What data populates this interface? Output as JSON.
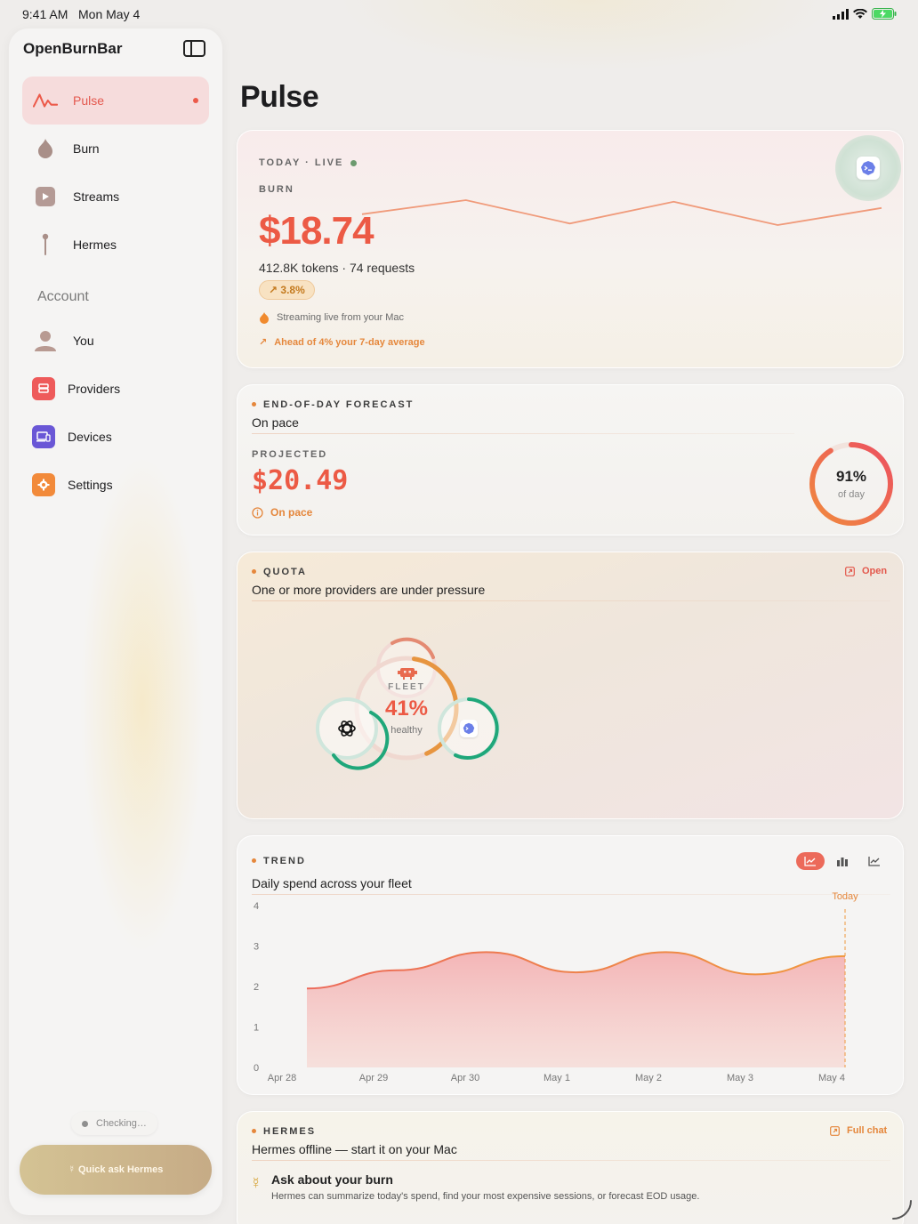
{
  "status_bar": {
    "time": "9:41 AM",
    "date": "Mon May 4"
  },
  "sidebar": {
    "title": "OpenBurnBar",
    "items": [
      {
        "label": "Pulse",
        "icon": "pulse-icon",
        "active": true
      },
      {
        "label": "Burn",
        "icon": "flame-icon"
      },
      {
        "label": "Streams",
        "icon": "play-icon"
      },
      {
        "label": "Hermes",
        "icon": "hermes-staff-icon"
      }
    ],
    "section_label": "Account",
    "account_items": [
      {
        "label": "You",
        "icon": "person-icon"
      },
      {
        "label": "Providers",
        "icon": "providers-icon"
      },
      {
        "label": "Devices",
        "icon": "devices-icon"
      },
      {
        "label": "Settings",
        "icon": "settings-icon"
      }
    ],
    "status": "Checking…",
    "quick_button": "☿ Quick ask Hermes"
  },
  "page": {
    "title": "Pulse"
  },
  "today": {
    "eyebrow": "TODAY · LIVE",
    "label": "BURN",
    "cost": "$18.74",
    "tokens": "412.8K tokens · 74 requests",
    "pct": "3.8%",
    "note1": "Streaming live from your Mac",
    "note2": "Ahead of 4% your 7-day average",
    "sparkline": [
      0.55,
      1.0,
      0.25,
      0.95,
      0.2,
      0.75
    ]
  },
  "forecast": {
    "eyebrow": "END-OF-DAY FORECAST",
    "subtitle": "On pace",
    "label": "PROJECTED",
    "value": "$20.49",
    "status": "On pace",
    "ring_pct": "91%",
    "ring_label": "of day",
    "ring_fraction": 0.91
  },
  "quota": {
    "eyebrow": "QUOTA",
    "subtitle": "One or more providers are under pressure",
    "open_label": "Open",
    "fleet_label": "FLEET",
    "fleet_pct": "41%",
    "fleet_status": "healthy",
    "fleet_fraction": 0.41
  },
  "trend": {
    "eyebrow": "TREND",
    "subtitle": "Daily spend across your fleet",
    "today_label": "Today",
    "view_modes": [
      "area-chart-icon",
      "bar-chart-icon",
      "line-chart-icon"
    ]
  },
  "chart_data": {
    "type": "area",
    "title": "Daily spend across your fleet",
    "categories": [
      "Apr 28",
      "Apr 29",
      "Apr 30",
      "May 1",
      "May 2",
      "May 3",
      "May 4"
    ],
    "x": [
      "Apr 28",
      "Apr 29",
      "Apr 30",
      "May 1",
      "May 2",
      "May 3",
      "May 4"
    ],
    "values": [
      1.95,
      2.4,
      2.85,
      2.35,
      2.85,
      2.3,
      2.75
    ],
    "ylim": [
      0,
      4
    ],
    "yticks": [
      "0",
      "1",
      "2",
      "3",
      "4"
    ],
    "grid": false,
    "xlabel": "",
    "ylabel": "",
    "colors": {
      "line_start": "#ec6a5a",
      "line_end": "#f0993e",
      "fill": "#f3b9b5"
    }
  },
  "hermes": {
    "eyebrow": "HERMES",
    "subtitle": "Hermes offline — start it on your Mac",
    "full_chat": "Full chat",
    "prompt_title": "Ask about your burn",
    "prompt_body": "Hermes can summarize today's spend, find your most expensive sessions, or forecast EOD usage."
  },
  "colors": {
    "accent": "#ec5a45",
    "accent_orange": "#f0993e",
    "live": "#6c9a6e",
    "provider_green": "#1fa77a"
  }
}
